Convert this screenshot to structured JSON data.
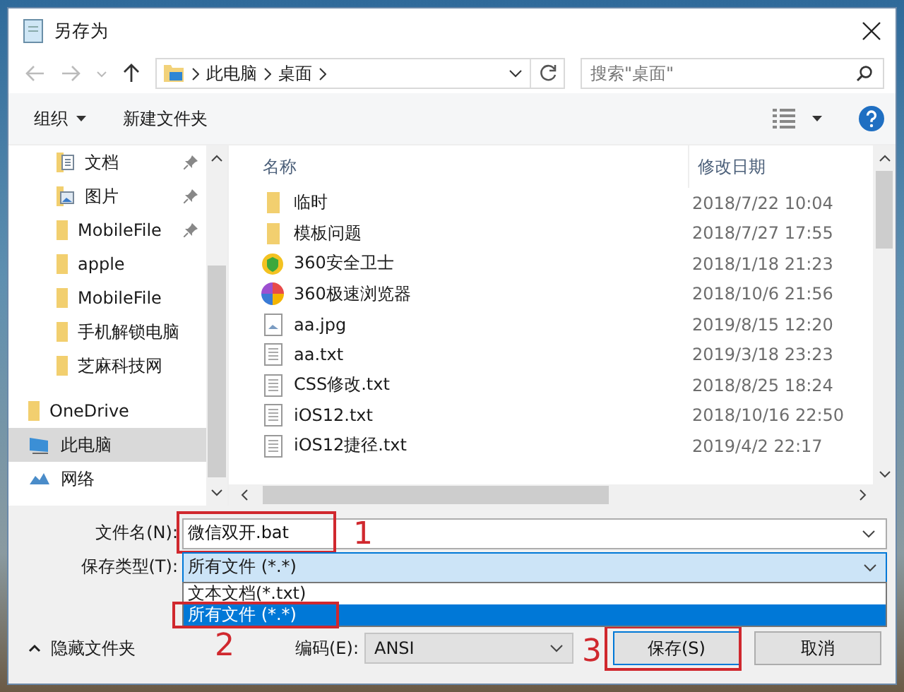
{
  "window": {
    "title": "另存为"
  },
  "address": {
    "crumbs": [
      "此电脑",
      "桌面"
    ]
  },
  "search": {
    "placeholder": "搜索\"桌面\""
  },
  "toolbar": {
    "organize": "组织",
    "new_folder": "新建文件夹"
  },
  "quick_access_items": [
    {
      "label": "文档",
      "kind": "document",
      "pinned": true
    },
    {
      "label": "图片",
      "kind": "picture",
      "pinned": true
    },
    {
      "label": "MobileFile",
      "kind": "folder",
      "pinned": true
    },
    {
      "label": "apple",
      "kind": "folder",
      "pinned": false
    },
    {
      "label": "MobileFile",
      "kind": "folder",
      "pinned": false
    },
    {
      "label": "手机解锁电脑",
      "kind": "folder",
      "pinned": false
    },
    {
      "label": "芝麻科技网",
      "kind": "folder",
      "pinned": false
    }
  ],
  "locations": [
    {
      "label": "OneDrive",
      "kind": "folder",
      "selected": false
    },
    {
      "label": "此电脑",
      "kind": "computer",
      "selected": true
    },
    {
      "label": "网络",
      "kind": "network",
      "selected": false
    }
  ],
  "file_list": {
    "columns": [
      "名称",
      "修改日期"
    ],
    "rows": [
      {
        "name": "临时",
        "date": "2018/7/22 10:04",
        "kind": "folder"
      },
      {
        "name": "模板问题",
        "date": "2018/7/27 17:55",
        "kind": "folder"
      },
      {
        "name": "360安全卫士",
        "date": "2018/1/18 21:23",
        "kind": "shield"
      },
      {
        "name": "360极速浏览器",
        "date": "2018/10/6 21:56",
        "kind": "browser"
      },
      {
        "name": "aa.jpg",
        "date": "2019/8/15 12:20",
        "kind": "image"
      },
      {
        "name": "aa.txt",
        "date": "2019/3/18 23:23",
        "kind": "text"
      },
      {
        "name": "CSS修改.txt",
        "date": "2018/8/25 18:24",
        "kind": "text"
      },
      {
        "name": "iOS12.txt",
        "date": "2018/10/16 22:50",
        "kind": "text"
      },
      {
        "name": "iOS12捷径.txt",
        "date": "2019/4/2 22:17",
        "kind": "text"
      }
    ]
  },
  "file_name": {
    "label": "文件名(N):",
    "value": "微信双开.bat",
    "annotation": "1"
  },
  "save_type": {
    "label": "保存类型(T):",
    "value": "所有文件 (*.*)",
    "options": [
      {
        "label": "文本文档(*.txt)",
        "selected": false
      },
      {
        "label": "所有文件 (*.*)",
        "selected": true,
        "annotation": "2"
      }
    ]
  },
  "hide_folders": "隐藏文件夹",
  "encoding": {
    "label": "编码(E):",
    "value": "ANSI"
  },
  "buttons": [
    {
      "label": "保存(S)",
      "kind": "save",
      "annotation": "3"
    },
    {
      "label": "取消",
      "kind": "cancel"
    }
  ]
}
